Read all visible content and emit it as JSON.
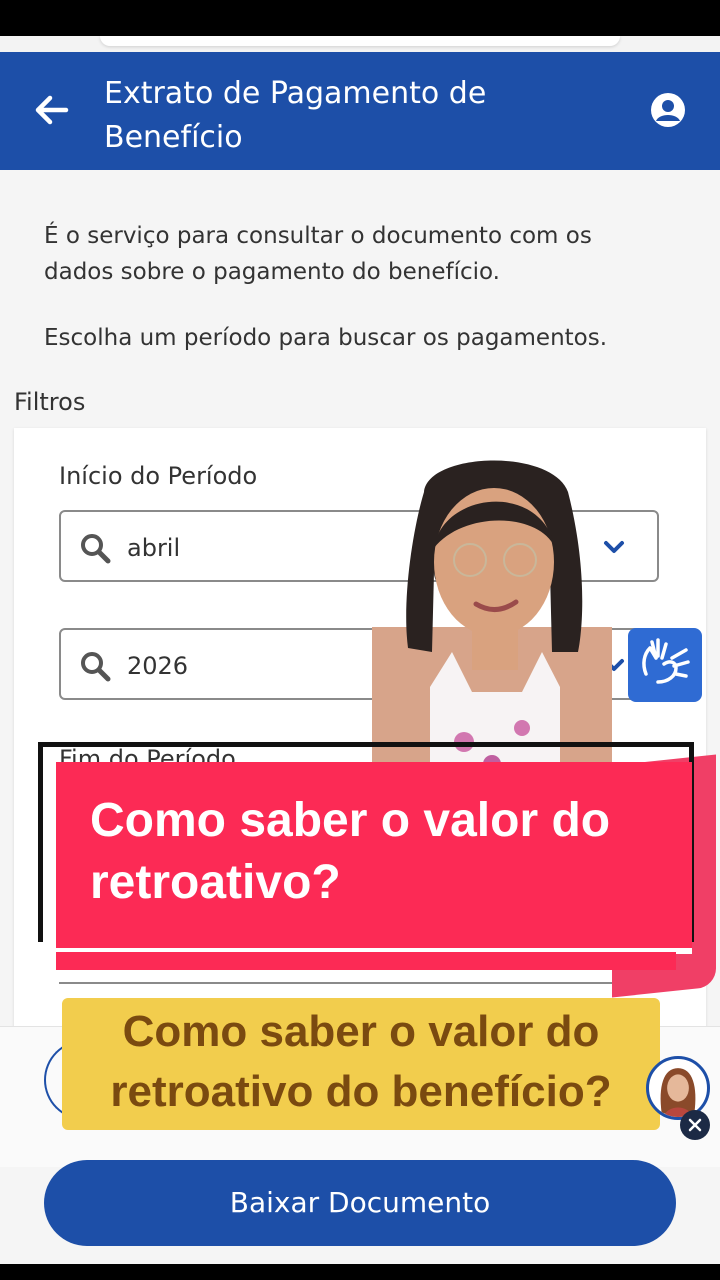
{
  "header": {
    "title": "Extrato de Pagamento de Benefício"
  },
  "intro": {
    "description": "É o serviço para consultar o documento com os dados sobre o pagamento do benefício.",
    "instruction": "Escolha um período para buscar os pagamentos."
  },
  "filters": {
    "label": "Filtros",
    "start_label": "Início do Período",
    "start_month": "abril",
    "start_year": "2026",
    "end_label": "Fim do Período"
  },
  "overlay": {
    "promo_title": "Como saber o valor do retroativo?",
    "caption": "Como saber o valor do retroativo do benefício?"
  },
  "actions": {
    "download_label": "Baixar Documento"
  },
  "colors": {
    "brand_blue": "#1d4fa8",
    "promo_red": "#fc2a55",
    "caption_yellow": "#f2cd4d"
  },
  "icons": [
    "back-arrow-icon",
    "user-profile-icon",
    "search-icon",
    "chevron-down-icon",
    "sign-language-icon",
    "close-icon"
  ]
}
